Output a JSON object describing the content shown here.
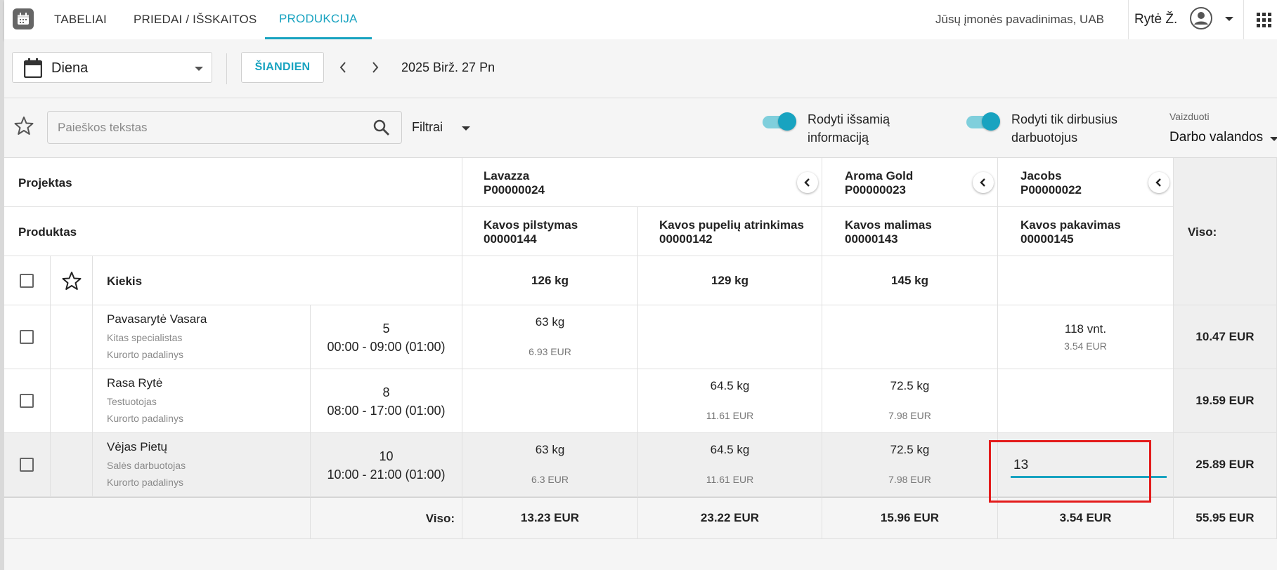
{
  "nav": {
    "tabs": [
      "TABELIAI",
      "PRIEDAI / IŠSKAITOS",
      "PRODUKCIJA"
    ],
    "active_tab": "PRODUKCIJA",
    "company": "Jūsų įmonės pavadinimas, UAB",
    "user": "Rytė Ž."
  },
  "toolbar": {
    "period": "Diena",
    "today_label": "ŠIANDIEN",
    "date": "2025 Birž. 27 Pn"
  },
  "filters": {
    "search_placeholder": "Paieškos tekstas",
    "filters_label": "Filtrai",
    "toggle_detail_label": "Rodyti išsamią informaciją",
    "toggle_detail_line1": "Rodyti išsamią",
    "toggle_detail_line2": "informaciją",
    "toggle_detail_on": true,
    "toggle_worked_line1": "Rodyti tik dirbusius",
    "toggle_worked_line2": "darbuotojus",
    "toggle_worked_on": true,
    "view_label": "Vaizduoti",
    "view_value": "Darbo valandos"
  },
  "table": {
    "project_header": "Projektas",
    "product_header": "Produktas",
    "quantity_header": "Kiekis",
    "total_header": "Viso:",
    "projects": [
      {
        "name": "Lavazza",
        "code": "P00000024"
      },
      {
        "name": "Aroma Gold",
        "code": "P00000023"
      },
      {
        "name": "Jacobs",
        "code": "P00000022"
      }
    ],
    "products": [
      {
        "name": "Kavos pilstymas",
        "code": "00000144",
        "quantity": "126 kg"
      },
      {
        "name": "Kavos pupelių atrinkimas",
        "code": "00000142",
        "quantity": "129 kg"
      },
      {
        "name": "Kavos malimas",
        "code": "00000143",
        "quantity": "145 kg"
      },
      {
        "name": "Kavos pakavimas",
        "code": "00000145",
        "quantity": ""
      }
    ],
    "rows": [
      {
        "name": "Pavasarytė Vasara",
        "role": "Kitas specialistas",
        "unit": "Kurorto padalinys",
        "hours_count": "5",
        "hours_range": "00:00 - 09:00 (01:00)",
        "cells": [
          {
            "qty": "63 kg",
            "eur": "6.93 EUR"
          },
          {
            "qty": "",
            "eur": ""
          },
          {
            "qty": "",
            "eur": ""
          },
          {
            "qty": "118 vnt.",
            "eur": "3.54 EUR"
          }
        ],
        "total": "10.47 EUR"
      },
      {
        "name": "Rasa Rytė",
        "role": "Testuotojas",
        "unit": "Kurorto padalinys",
        "hours_count": "8",
        "hours_range": "08:00 - 17:00 (01:00)",
        "cells": [
          {
            "qty": "",
            "eur": ""
          },
          {
            "qty": "64.5 kg",
            "eur": "11.61 EUR"
          },
          {
            "qty": "72.5 kg",
            "eur": "7.98 EUR"
          },
          {
            "qty": "",
            "eur": ""
          }
        ],
        "total": "19.59 EUR"
      },
      {
        "name": "Vėjas Pietų",
        "role": "Salės darbuotojas",
        "unit": "Kurorto padalinys",
        "hours_count": "10",
        "hours_range": "10:00 - 21:00 (01:00)",
        "cells": [
          {
            "qty": "63 kg",
            "eur": "6.3 EUR"
          },
          {
            "qty": "64.5 kg",
            "eur": "11.61 EUR"
          },
          {
            "qty": "72.5 kg",
            "eur": "7.98 EUR"
          },
          {
            "qty": "",
            "eur": ""
          }
        ],
        "edit_value": "13",
        "total": "25.89 EUR"
      }
    ],
    "footer_label": "Viso:",
    "footer_totals": [
      "13.23 EUR",
      "23.22 EUR",
      "15.96 EUR",
      "3.54 EUR"
    ],
    "grand_total": "55.95 EUR"
  },
  "colors": {
    "accent": "#18a3c0",
    "highlight": "#e31b1b"
  }
}
